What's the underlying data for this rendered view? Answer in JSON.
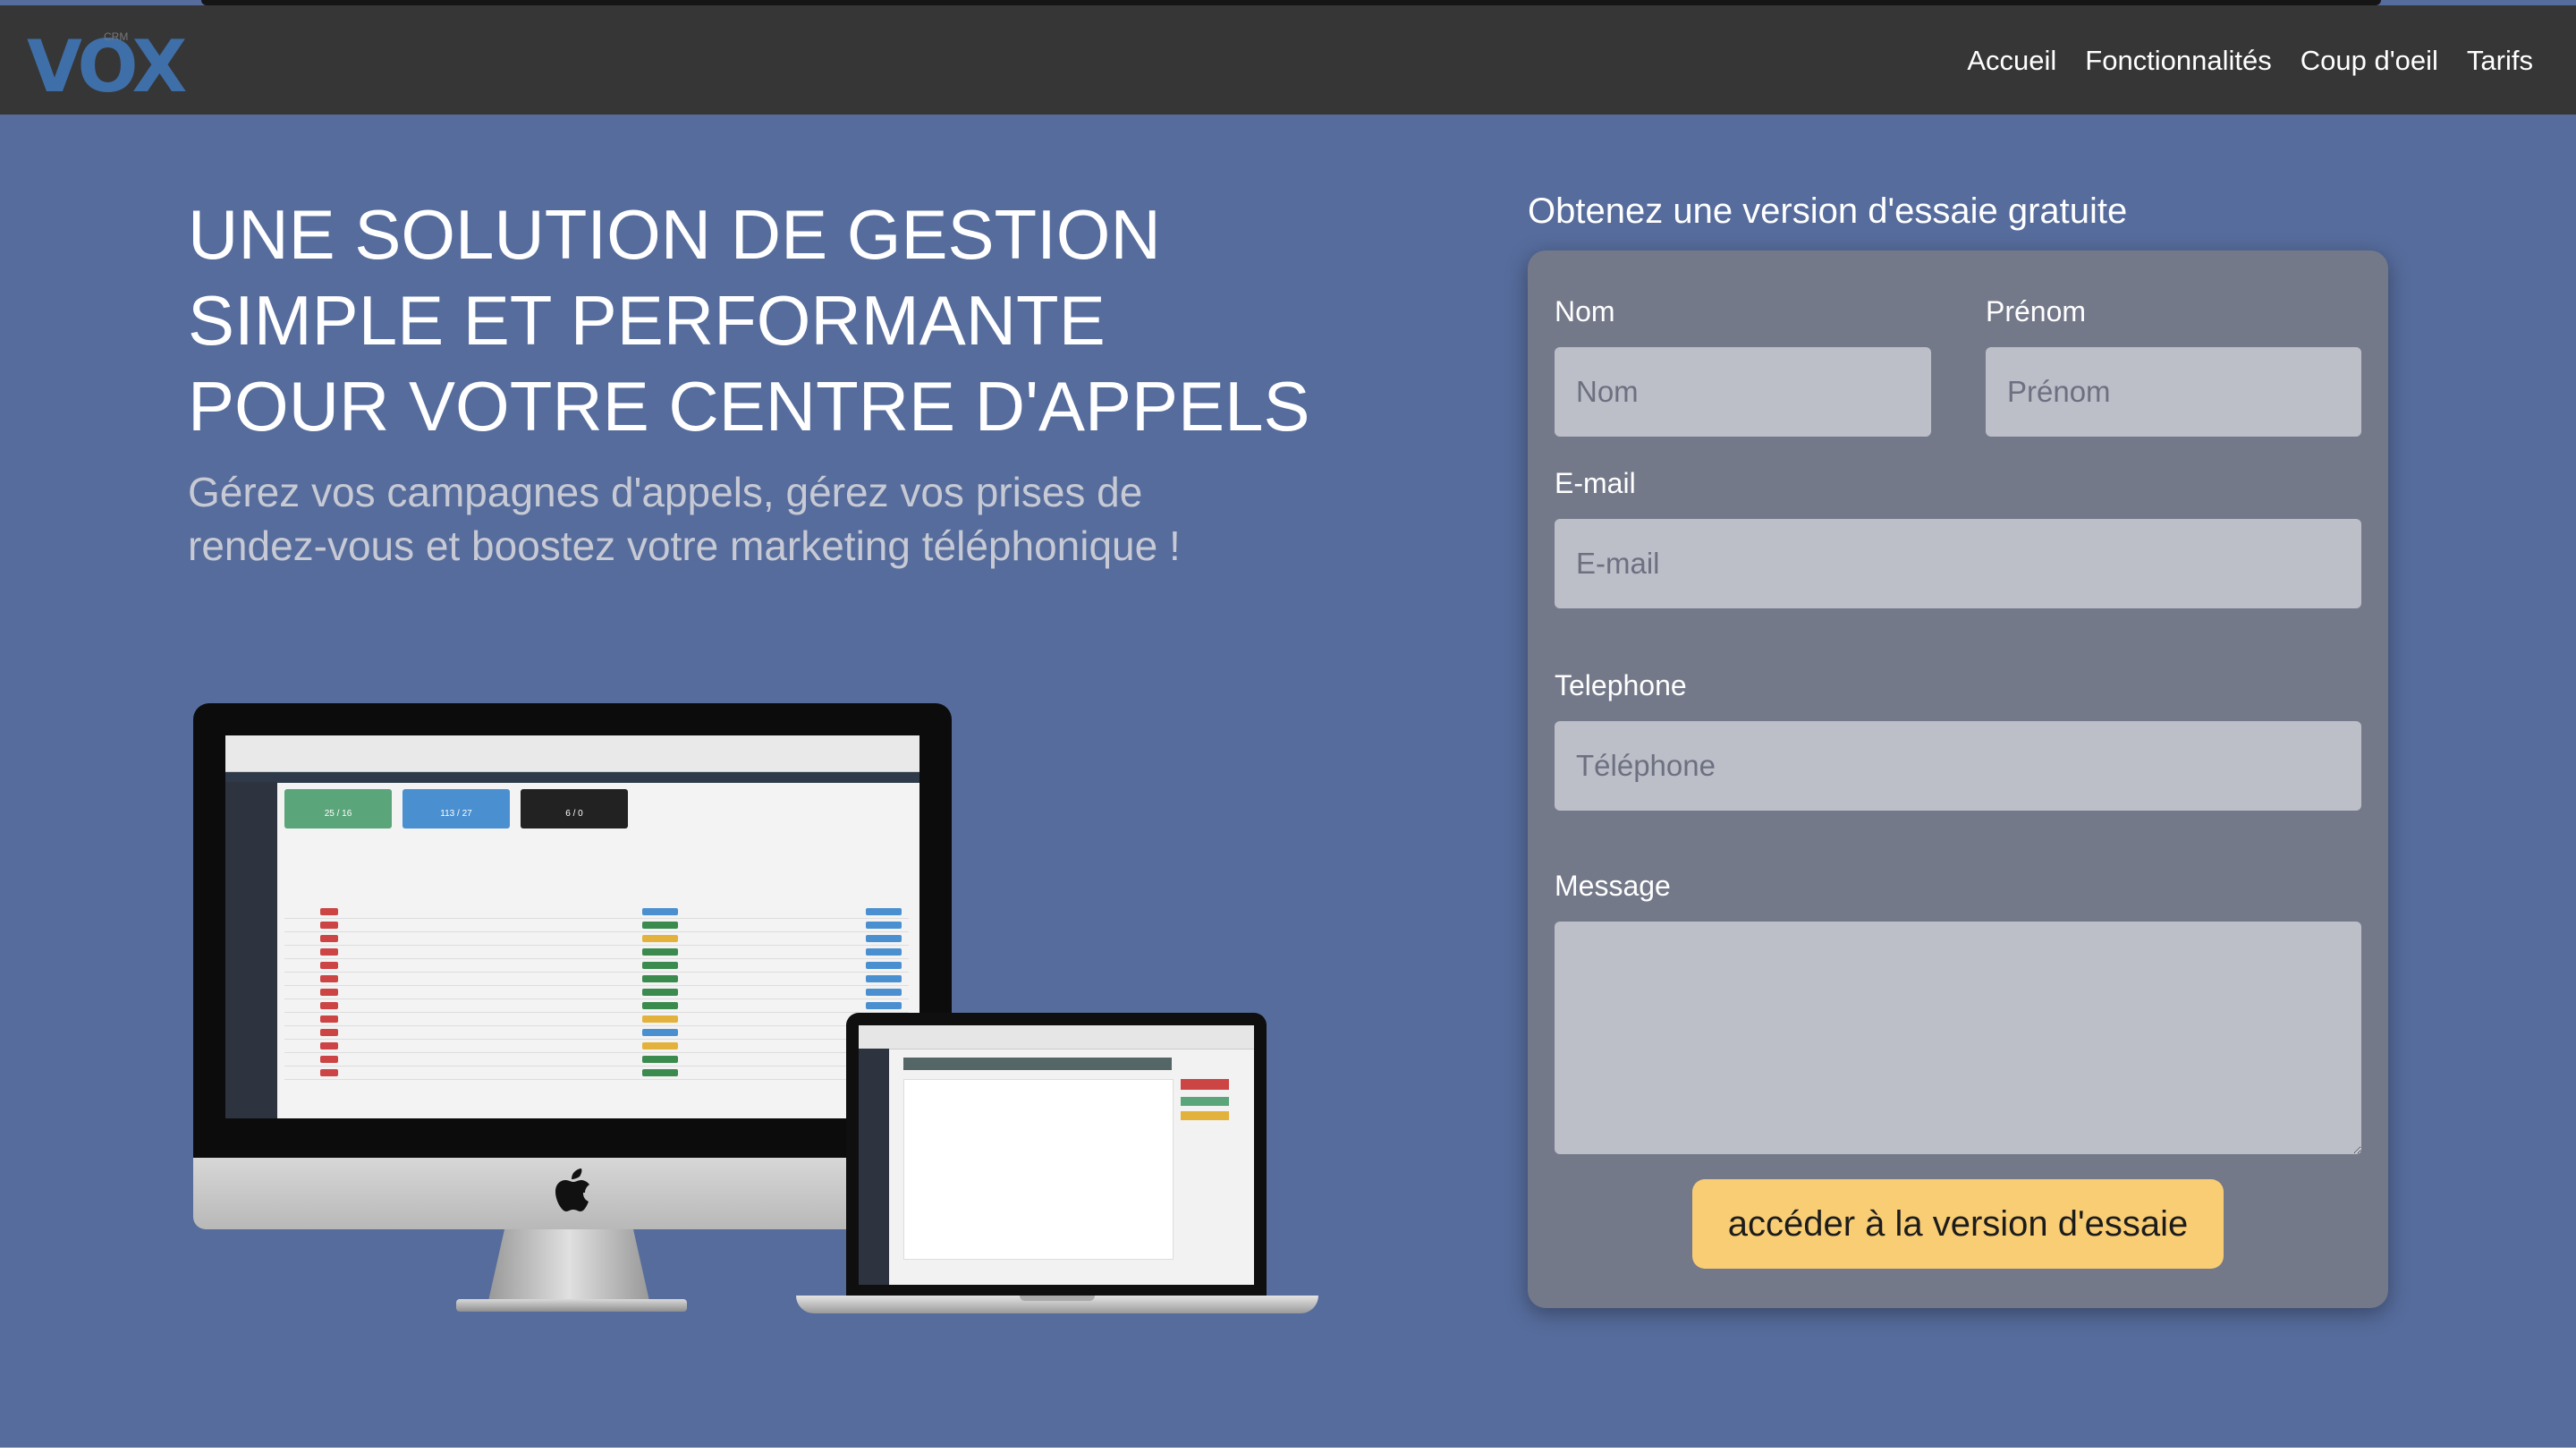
{
  "brand": {
    "logo": "VOX",
    "logo_small": "CRM"
  },
  "nav": {
    "items": [
      "Accueil",
      "Fonctionnalités",
      "Coup d'oeil",
      "Tarifs"
    ]
  },
  "hero": {
    "headline": [
      "UNE SOLUTION DE GESTION",
      "SIMPLE ET PERFORMANTE",
      "POUR VOTRE CENTRE D'APPELS"
    ],
    "subline": [
      "Gérez vos campagnes d'appels, gérez vos prises de",
      "rendez-vous et boostez votre marketing téléphonique !"
    ]
  },
  "devices": {
    "imac_icon": "apple-logo-icon",
    "card_values": [
      "25 / 16",
      "113 / 27",
      "6 / 0"
    ]
  },
  "form": {
    "heading": "Obtenez une version d'essaie gratuite",
    "nom_label": "Nom",
    "nom_placeholder": "Nom",
    "prenom_label": "Prénom",
    "prenom_placeholder": "Prénom",
    "email_label": "E-mail",
    "email_placeholder": "E-mail",
    "phone_label": "Telephone",
    "phone_placeholder": "Téléphone",
    "message_label": "Message",
    "message_placeholder": "",
    "submit_label": "accéder à la version d'essaie"
  },
  "colors": {
    "background": "#566c9c",
    "navbar": "#363636",
    "form_card": "#74798a",
    "input": "#bcbec8",
    "submit": "#f8cd74",
    "logo": "#3f6fa8"
  }
}
